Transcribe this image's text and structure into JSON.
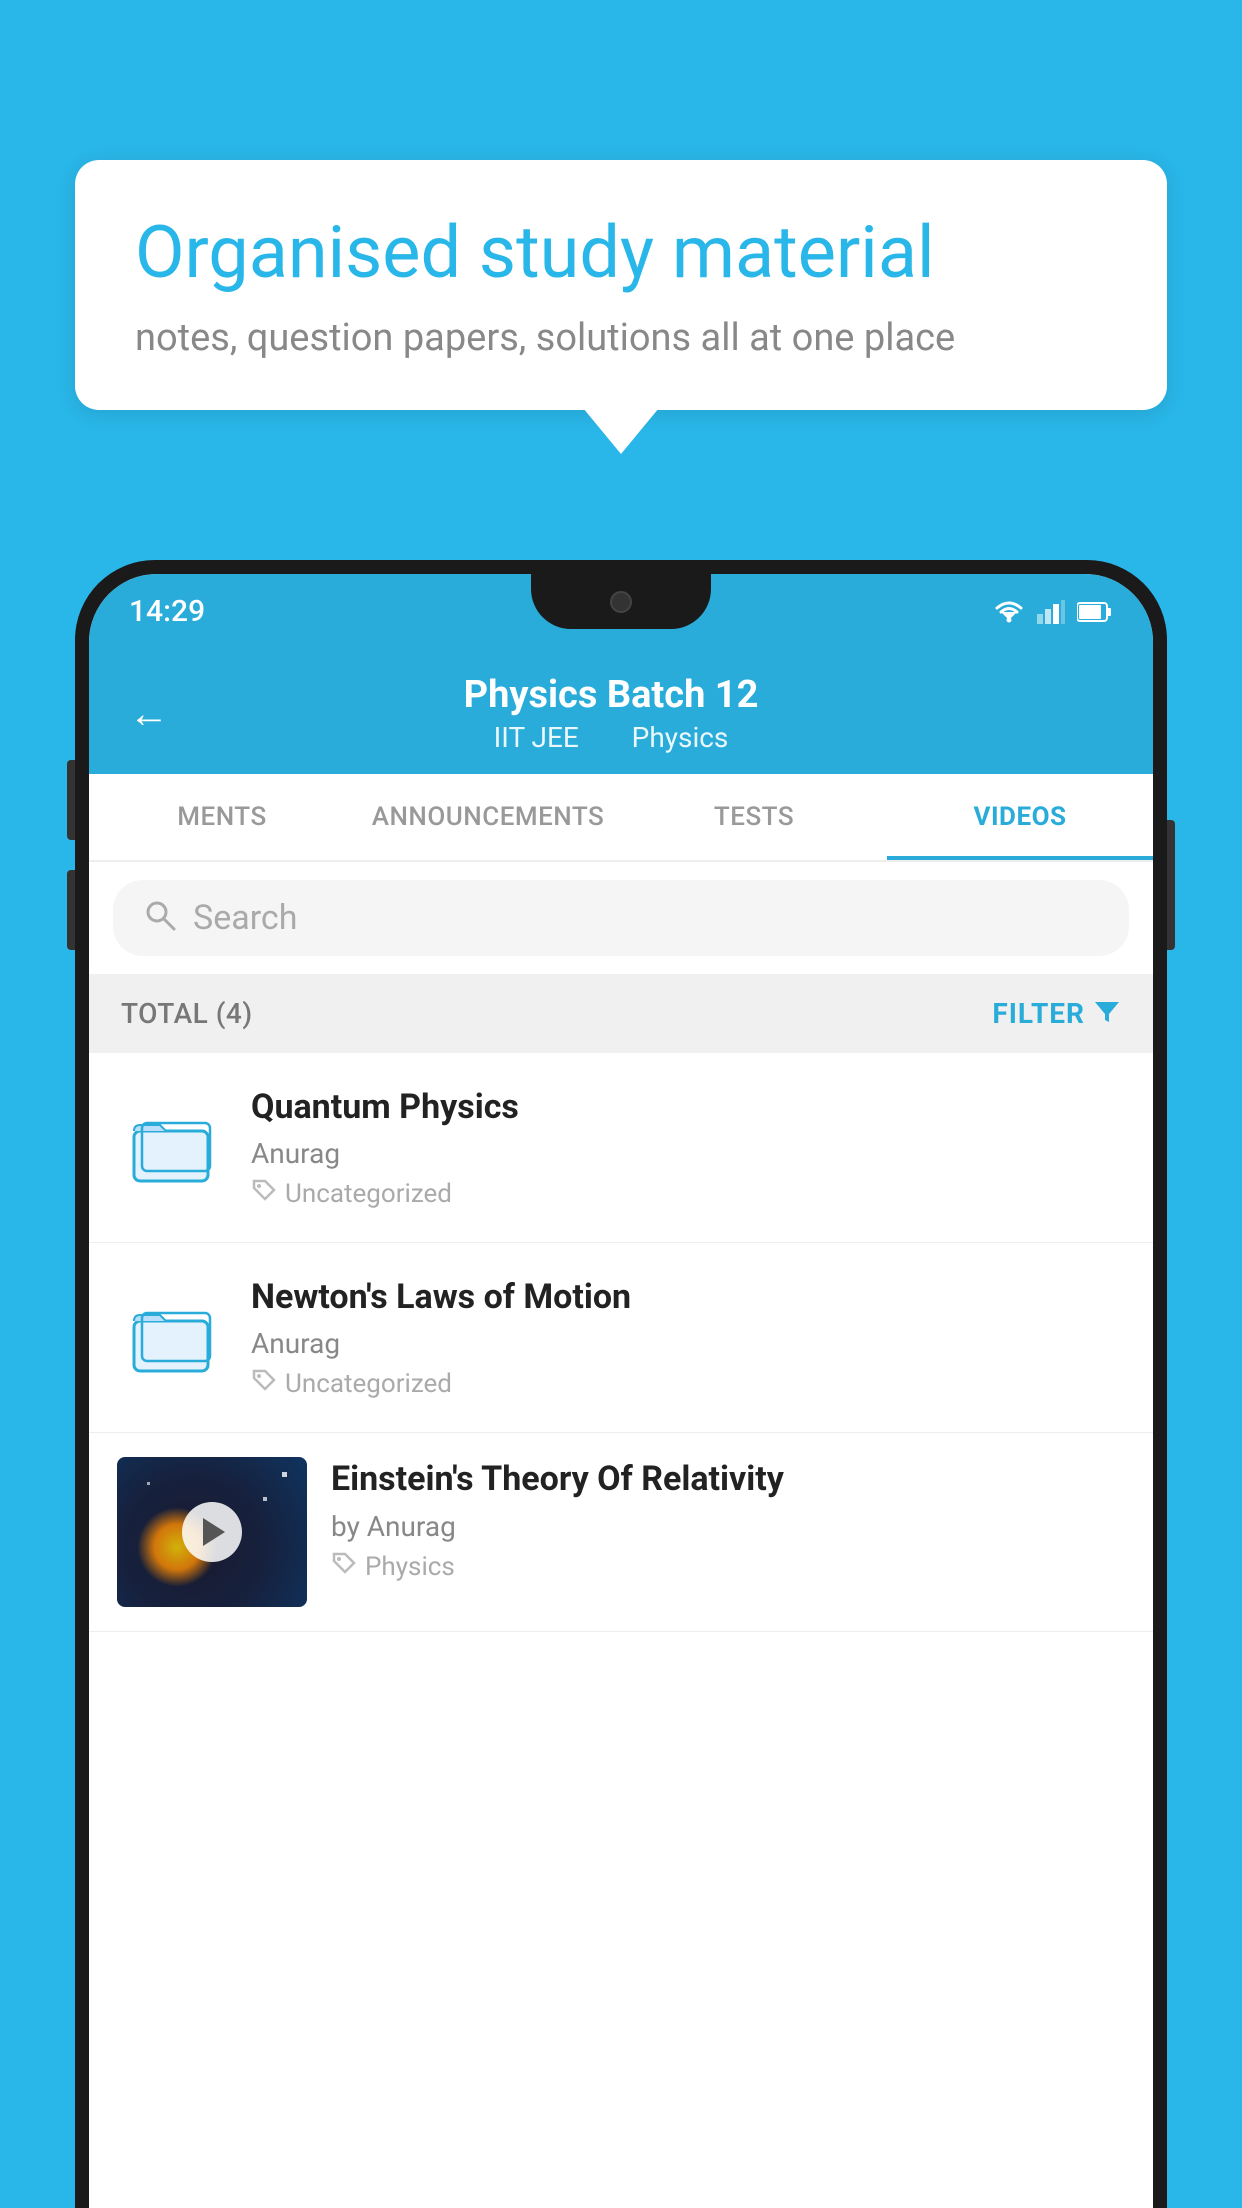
{
  "background_color": "#29b6e8",
  "bubble": {
    "title": "Organised study material",
    "subtitle": "notes, question papers, solutions all at one place"
  },
  "phone": {
    "status_bar": {
      "time": "14:29"
    },
    "header": {
      "title": "Physics Batch 12",
      "subtitle_part1": "IIT JEE",
      "subtitle_part2": "Physics",
      "back_label": "←"
    },
    "tabs": [
      {
        "label": "MENTS",
        "active": false
      },
      {
        "label": "ANNOUNCEMENTS",
        "active": false
      },
      {
        "label": "TESTS",
        "active": false
      },
      {
        "label": "VIDEOS",
        "active": true
      }
    ],
    "search": {
      "placeholder": "Search"
    },
    "filter_bar": {
      "total": "TOTAL (4)",
      "filter_label": "FILTER"
    },
    "videos": [
      {
        "title": "Quantum Physics",
        "author": "Anurag",
        "tag": "Uncategorized",
        "type": "folder"
      },
      {
        "title": "Newton's Laws of Motion",
        "author": "Anurag",
        "tag": "Uncategorized",
        "type": "folder"
      },
      {
        "title": "Einstein's Theory Of Relativity",
        "author": "by Anurag",
        "tag": "Physics",
        "type": "video"
      }
    ]
  }
}
